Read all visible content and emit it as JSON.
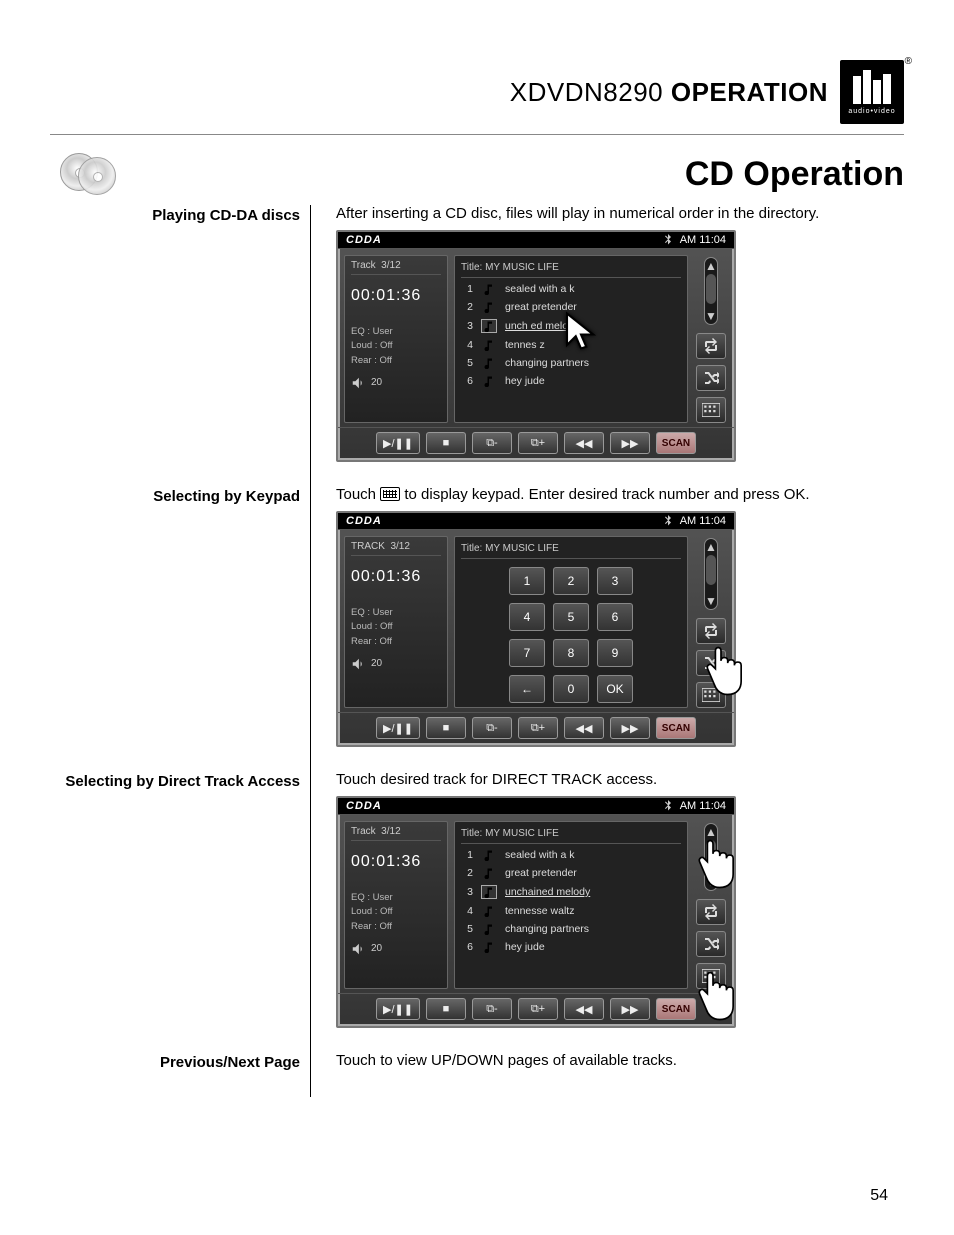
{
  "header": {
    "model": "XDVDN8290",
    "word": "OPERATION",
    "logo_sub": "audio•video"
  },
  "page_title": "CD Operation",
  "page_number": "54",
  "sections": {
    "s1": {
      "label": "Playing CD-DA discs",
      "text": "After inserting a CD disc, files will play in numerical order in the directory."
    },
    "s2": {
      "label": "Selecting by Keypad",
      "text_a": "Touch ",
      "text_b": " to display keypad. Enter desired track number and press OK."
    },
    "s3": {
      "label": "Selecting by Direct Track Access",
      "text": "Touch desired track for DIRECT TRACK access."
    },
    "s4": {
      "label": "Previous/Next Page",
      "text": "Touch to view UP/DOWN pages of available tracks."
    }
  },
  "device_common": {
    "brand": "CDDA",
    "time": "AM 11:04",
    "track_label": "Track",
    "track_value": "3/12",
    "track_label_upper": "TRACK",
    "elapsed": "00:01:36",
    "eq": "EQ   : User",
    "loud": "Loud : Off",
    "rear": "Rear : Off",
    "vol": "20",
    "title_prefix": "Title:",
    "title": "MY  MUSIC LIFE",
    "bottom": {
      "scan": "SCAN"
    }
  },
  "tracks_full": [
    {
      "n": "1",
      "name": "sealed with a k"
    },
    {
      "n": "2",
      "name": "great pretender"
    },
    {
      "n": "3",
      "name": "unchained melody"
    },
    {
      "n": "4",
      "name": "tennesse waltz"
    },
    {
      "n": "5",
      "name": "changing partners"
    },
    {
      "n": "6",
      "name": "hey jude"
    }
  ],
  "tracks_cursor": [
    {
      "n": "1",
      "name": "sealed with a k"
    },
    {
      "n": "2",
      "name": "great pretender"
    },
    {
      "n": "3",
      "name": "unch     ed melody"
    },
    {
      "n": "4",
      "name": "tennes        z"
    },
    {
      "n": "5",
      "name": "changing partners"
    },
    {
      "n": "6",
      "name": "hey jude"
    }
  ],
  "keypad": {
    "keys": [
      "1",
      "2",
      "3",
      "4",
      "5",
      "6",
      "7",
      "8",
      "9"
    ],
    "back": "←",
    "zero": "0",
    "ok": "OK"
  }
}
